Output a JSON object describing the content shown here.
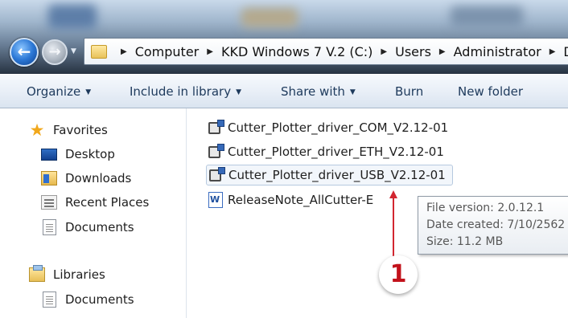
{
  "address_bar": {
    "breadcrumbs": [
      "Computer",
      "KKD Windows 7 V.2 (C:)",
      "Users",
      "Administrator",
      "D"
    ]
  },
  "command_bar": {
    "organize": "Organize",
    "include_in_library": "Include in library",
    "share_with": "Share with",
    "burn": "Burn",
    "new_folder": "New folder"
  },
  "nav_pane": {
    "favorites": {
      "label": "Favorites",
      "items": [
        "Desktop",
        "Downloads",
        "Recent Places",
        "Documents"
      ]
    },
    "libraries": {
      "label": "Libraries",
      "items": [
        "Documents"
      ]
    }
  },
  "files": [
    {
      "name": "Cutter_Plotter_driver_COM_V2.12-01",
      "icon": "setup-icon"
    },
    {
      "name": "Cutter_Plotter_driver_ETH_V2.12-01",
      "icon": "setup-icon"
    },
    {
      "name": "Cutter_Plotter_driver_USB_V2.12-01",
      "icon": "setup-icon",
      "selected": true
    },
    {
      "name": "ReleaseNote_AllCutter-E",
      "icon": "word-document-icon"
    }
  ],
  "tooltip": {
    "file_version": "File version: 2.0.12.1",
    "date_created": "Date created: 7/10/2562",
    "size": "Size: 11.2 MB"
  },
  "annotation": {
    "number": "1",
    "color": "#c2121b"
  }
}
